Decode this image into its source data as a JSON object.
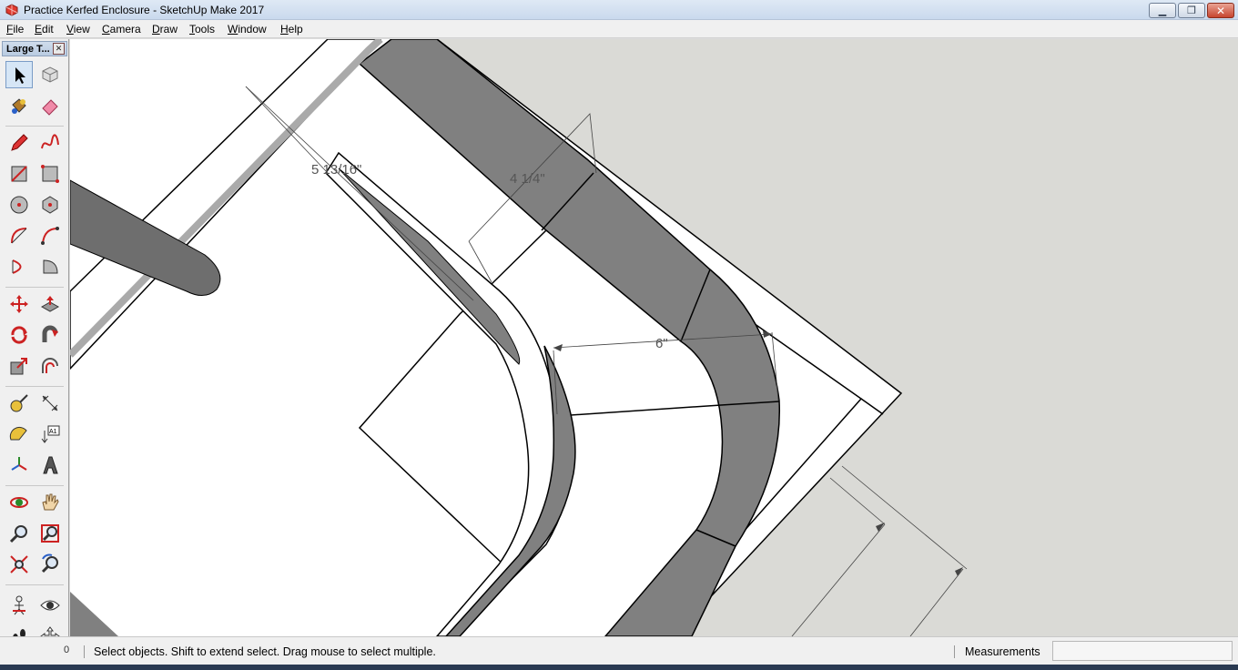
{
  "window": {
    "title": "Practice Kerfed Enclosure - SketchUp Make 2017",
    "minimize_glyph": "▁",
    "restore_glyph": "❐",
    "close_glyph": "✕"
  },
  "menu": {
    "items": [
      {
        "label": "File",
        "key": "F",
        "rest": "ile"
      },
      {
        "label": "Edit",
        "key": "E",
        "rest": "dit"
      },
      {
        "label": "View",
        "key": "V",
        "rest": "iew"
      },
      {
        "label": "Camera",
        "key": "C",
        "rest": "amera"
      },
      {
        "label": "Draw",
        "key": "D",
        "rest": "raw"
      },
      {
        "label": "Tools",
        "key": "T",
        "rest": "ools"
      },
      {
        "label": "Window",
        "key": "W",
        "rest": "indow"
      },
      {
        "label": "Help",
        "key": "H",
        "rest": "elp"
      }
    ]
  },
  "toolbar": {
    "title": "Large T...",
    "close_glyph": "✕",
    "tools": [
      {
        "name": "select-tool",
        "icon": "arrow-cursor-icon"
      },
      {
        "name": "make-component-tool",
        "icon": "component-box-icon"
      },
      {
        "name": "paint-bucket-tool",
        "icon": "paint-bucket-icon"
      },
      {
        "name": "eraser-tool",
        "icon": "eraser-icon"
      },
      {
        "name": "line-tool",
        "icon": "pencil-icon"
      },
      {
        "name": "freehand-tool",
        "icon": "freehand-icon"
      },
      {
        "name": "rectangle-tool",
        "icon": "rectangle-icon"
      },
      {
        "name": "rotated-rectangle-tool",
        "icon": "rotated-rectangle-icon"
      },
      {
        "name": "circle-tool",
        "icon": "circle-icon"
      },
      {
        "name": "polygon-tool",
        "icon": "polygon-icon"
      },
      {
        "name": "arc-tool",
        "icon": "arc-icon"
      },
      {
        "name": "two-point-arc-tool",
        "icon": "two-point-arc-icon"
      },
      {
        "name": "three-point-arc-tool",
        "icon": "three-point-arc-icon"
      },
      {
        "name": "pie-tool",
        "icon": "pie-icon"
      },
      {
        "name": "move-tool",
        "icon": "move-arrows-icon"
      },
      {
        "name": "push-pull-tool",
        "icon": "push-pull-icon"
      },
      {
        "name": "rotate-tool",
        "icon": "rotate-icon"
      },
      {
        "name": "follow-me-tool",
        "icon": "follow-me-icon"
      },
      {
        "name": "scale-tool",
        "icon": "scale-icon"
      },
      {
        "name": "offset-tool",
        "icon": "offset-icon"
      },
      {
        "name": "tape-measure-tool",
        "icon": "tape-measure-icon"
      },
      {
        "name": "dimension-tool",
        "icon": "dimension-icon"
      },
      {
        "name": "protractor-tool",
        "icon": "protractor-icon"
      },
      {
        "name": "text-tool",
        "icon": "text-label-icon",
        "text": "A1"
      },
      {
        "name": "axes-tool",
        "icon": "axes-icon"
      },
      {
        "name": "3d-text-tool",
        "icon": "3d-text-icon"
      },
      {
        "name": "orbit-tool",
        "icon": "orbit-icon"
      },
      {
        "name": "pan-tool",
        "icon": "hand-icon"
      },
      {
        "name": "zoom-tool",
        "icon": "magnifier-icon"
      },
      {
        "name": "zoom-window-tool",
        "icon": "zoom-window-icon"
      },
      {
        "name": "zoom-extents-tool",
        "icon": "zoom-extents-icon"
      },
      {
        "name": "previous-view-tool",
        "icon": "previous-view-icon"
      },
      {
        "name": "position-camera-tool",
        "icon": "position-camera-icon"
      },
      {
        "name": "look-around-tool",
        "icon": "eye-icon"
      },
      {
        "name": "walk-tool",
        "icon": "footprints-icon"
      },
      {
        "name": "section-plane-tool",
        "icon": "section-plane-icon"
      }
    ]
  },
  "viewport": {
    "dimensions": [
      {
        "label": "5 13/16\""
      },
      {
        "label": "4 1/4\""
      },
      {
        "label": "6\""
      }
    ]
  },
  "status": {
    "geo_glyph": "0",
    "message": "Select objects. Shift to extend select. Drag mouse to select multiple.",
    "measurements_label": "Measurements",
    "measurements_value": ""
  },
  "colors": {
    "canvas": "#dadad6",
    "face_white": "#ffffff",
    "face_gray": "#808080",
    "edge": "#000000"
  }
}
